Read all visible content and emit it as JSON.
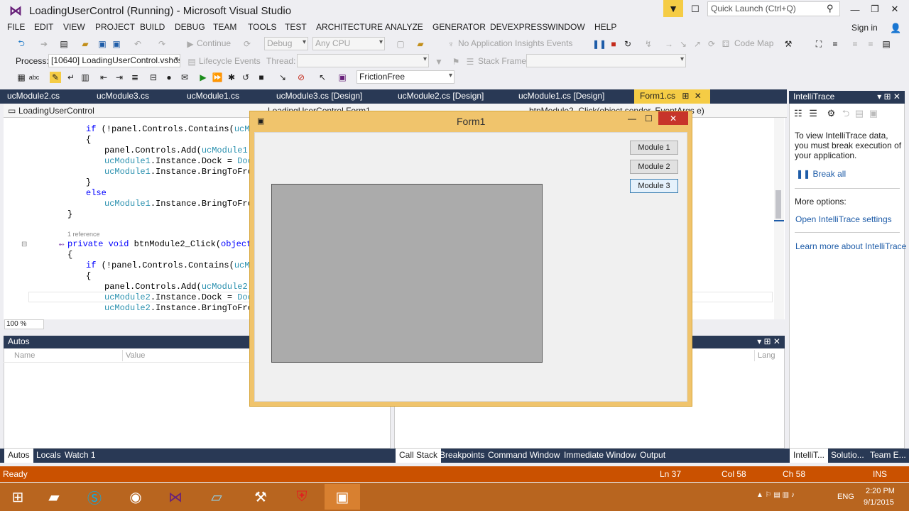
{
  "title_bar": {
    "title": "LoadingUserControl (Running) - Microsoft Visual Studio",
    "quick_launch_placeholder": "Quick Launch (Ctrl+Q)"
  },
  "menu": {
    "items": [
      "FILE",
      "EDIT",
      "VIEW",
      "PROJECT",
      "BUILD",
      "DEBUG",
      "TEAM",
      "TOOLS",
      "TEST",
      "ARCHITECTURE",
      "ANALYZE",
      "GENERATOR",
      "DEVEXPRESS",
      "WINDOW",
      "HELP"
    ],
    "sign_in": "Sign in"
  },
  "toolbar1": {
    "continue": "Continue",
    "config": "Debug",
    "platform": "Any CPU",
    "insights": "No Application Insights Events",
    "code_map": "Code Map"
  },
  "toolbar2": {
    "process_label": "Process:",
    "process_value": "[10640] LoadingUserControl.vshos",
    "lifecycle": "Lifecycle Events",
    "thread_label": "Thread:",
    "stack_frame_label": "Stack Frame:"
  },
  "toolbar3": {
    "friction": "FrictionFree"
  },
  "doc_tabs": [
    "ucModule2.cs",
    "ucModule3.cs",
    "ucModule1.cs",
    "ucModule3.cs [Design]",
    "ucModule2.cs [Design]",
    "ucModule1.cs [Design]",
    "Form1.cs"
  ],
  "editor": {
    "nav_left": "LoadingUserControl",
    "nav_mid": "LoadingUserControl.Form1",
    "nav_right": "btnModule2_Click(object sender, EventArgs e)",
    "reference_lens": "1 reference",
    "zoom": "100 %",
    "lines": [
      "if (!panel.Controls.Contains(ucModu",
      "{",
      "panel.Controls.Add(ucModule1.In",
      "ucModule1.Instance.Dock = DockS",
      "ucModule1.Instance.BringToFront",
      "}",
      "else",
      "ucModule1.Instance.BringToFront",
      "}",
      "private void btnModule2_Click(object se",
      "{",
      "if (!panel.Controls.Contains(ucModu",
      "{",
      "panel.Controls.Add(ucModule2.In",
      "ucModule2.Instance.Dock = DockS",
      "ucModule2.Instance.BringToFront"
    ]
  },
  "form1": {
    "title": "Form1",
    "buttons": [
      "Module 1",
      "Module 2",
      "Module 3"
    ]
  },
  "intellitrace": {
    "title": "IntelliTrace",
    "message": "To view IntelliTrace data, you must break execution of your application.",
    "break_all": "Break all",
    "more_options": "More options:",
    "open_settings": "Open IntelliTrace settings",
    "learn_more": "Learn more about IntelliTrace"
  },
  "autos": {
    "title": "Autos",
    "col_name": "Name",
    "col_value": "Value",
    "col_lang": "Lang"
  },
  "bottom_tabs_left": [
    "Autos",
    "Locals",
    "Watch 1"
  ],
  "bottom_tabs_right": [
    "Call Stack",
    "Breakpoints",
    "Command Window",
    "Immediate Window",
    "Output"
  ],
  "bottom_tabs_side": [
    "IntelliT...",
    "Solutio...",
    "Team E..."
  ],
  "status": {
    "ready": "Ready",
    "ln": "Ln 37",
    "col": "Col 58",
    "ch": "Ch 58",
    "ins": "INS"
  },
  "taskbar": {
    "lang": "ENG",
    "time": "2:20 PM",
    "date": "9/1/2015"
  }
}
